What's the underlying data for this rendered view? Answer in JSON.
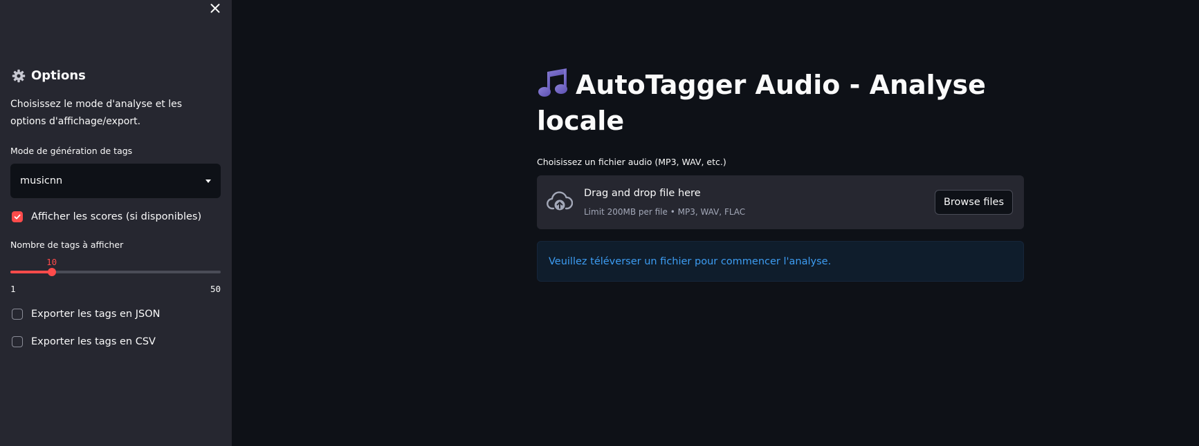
{
  "sidebar": {
    "close_icon": "close-icon",
    "header": {
      "icon": "gear-icon",
      "title": "Options"
    },
    "description": "Choisissez le mode d'analyse et les options d'affichage/export.",
    "mode_select": {
      "label": "Mode de génération de tags",
      "value": "musicnn"
    },
    "show_scores": {
      "label": "Afficher les scores (si disponibles)",
      "checked": true
    },
    "tag_count_slider": {
      "label": "Nombre de tags à afficher",
      "value": 10,
      "min": 1,
      "max": 50,
      "value_text": "10",
      "min_text": "1",
      "max_text": "50"
    },
    "export_json": {
      "label": "Exporter les tags en JSON",
      "checked": false
    },
    "export_csv": {
      "label": "Exporter les tags en CSV",
      "checked": false
    }
  },
  "main": {
    "title_icon": "music-note-icon",
    "title": "AutoTagger Audio - Analyse locale",
    "uploader": {
      "label": "Choisissez un fichier audio (MP3, WAV, etc.)",
      "icon": "cloud-upload-icon",
      "drop_text": "Drag and drop file here",
      "limit_text": "Limit 200MB per file • MP3, WAV, FLAC",
      "browse_label": "Browse files"
    },
    "info_message": "Veuillez téléverser un fichier pour commencer l'analyse."
  },
  "colors": {
    "background": "#0e1117",
    "sidebar": "#262730",
    "accent": "#ff4b4b",
    "info_text": "#3d9df3",
    "info_bg": "#0f1d2c"
  }
}
